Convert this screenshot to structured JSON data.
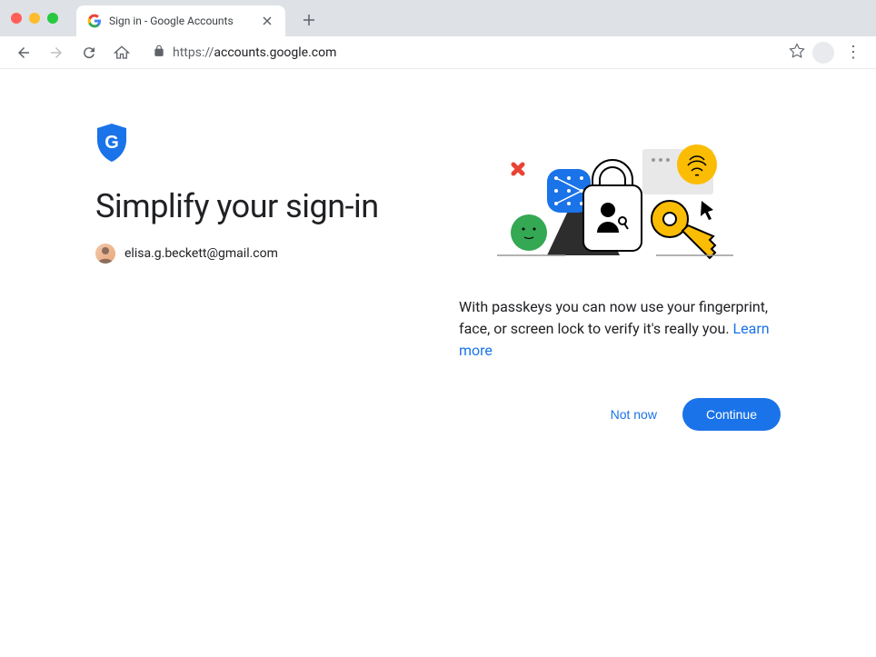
{
  "browser": {
    "tab": {
      "title": "Sign in - Google Accounts"
    },
    "url_scheme": "https://",
    "url_host": "accounts.google.com"
  },
  "page": {
    "heading": "Simplify your sign-in",
    "account_email": "elisa.g.beckett@gmail.com",
    "description_text": "With passkeys you can now use your fingerprint, face, or screen lock to verify it's really you. ",
    "learn_more_label": "Learn more",
    "not_now_label": "Not now",
    "continue_label": "Continue"
  }
}
